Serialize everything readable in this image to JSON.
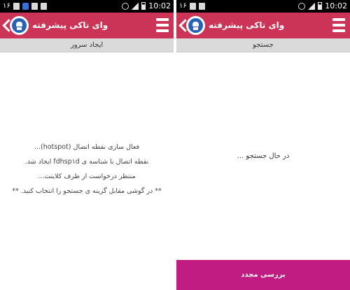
{
  "left_screen": {
    "status_bar": {
      "notification_number": "۱۶",
      "time": "10:02"
    },
    "app_bar": {
      "title": "وای تاکی پیشرفته"
    },
    "sub_header": "ایجاد سرور",
    "messages": [
      "فعال سازی نقطه اتصال (hotspot)...",
      "نقطه اتصال با شناسه ی fdhsp۱d ایجاد شد.",
      "منتظر درخواست از طرف کلاینت...",
      "** در گوشی مقابل گزینه ی جستجو را انتخاب کنید. **"
    ]
  },
  "right_screen": {
    "status_bar": {
      "notification_number": "۱۶",
      "time": "10:02"
    },
    "app_bar": {
      "title": "وای تاکی پیشرفته"
    },
    "sub_header": "جستجو",
    "status_text": "در حال جستجو ...",
    "retry_button": "بررسی مجدد"
  },
  "icons": {
    "back": "back-arrow-icon",
    "logo": "android-logo-icon",
    "menu": "hamburger-menu-icon"
  },
  "colors": {
    "status_bar": "#000000",
    "app_bar": "#cb3456",
    "sub_header": "#dadada",
    "retry_button": "#c01c82"
  }
}
